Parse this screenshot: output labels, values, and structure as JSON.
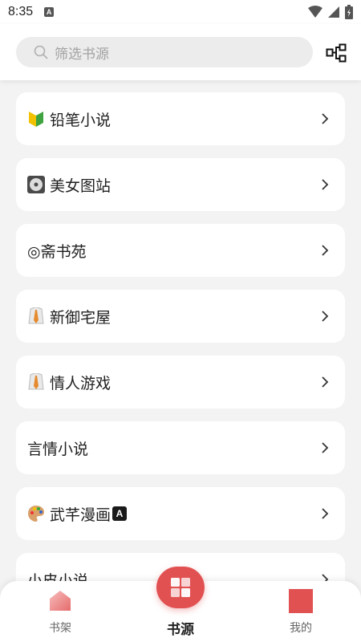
{
  "status_bar": {
    "time": "8:35",
    "notification_icon": "A"
  },
  "search": {
    "placeholder": "筛选书源"
  },
  "sources": [
    {
      "label": "铅笔小说",
      "icon": "beginner-badge-icon"
    },
    {
      "label": "美女图站",
      "icon": "dvd-icon"
    },
    {
      "label": "◎斋书苑",
      "icon": ""
    },
    {
      "label": "新御宅屋",
      "icon": "shirt-tie-icon"
    },
    {
      "label": "情人游戏",
      "icon": "shirt-tie-icon"
    },
    {
      "label": "言情小说",
      "icon": ""
    },
    {
      "label": "武芊漫画",
      "icon": "palette-icon",
      "badge": "A"
    },
    {
      "label": "小皮小说",
      "icon": ""
    }
  ],
  "nav": {
    "bookshelf": "书架",
    "sources": "书源",
    "mine": "我的"
  },
  "colors": {
    "accent": "#e15152",
    "background": "#f3f3f3",
    "card": "#ffffff"
  }
}
